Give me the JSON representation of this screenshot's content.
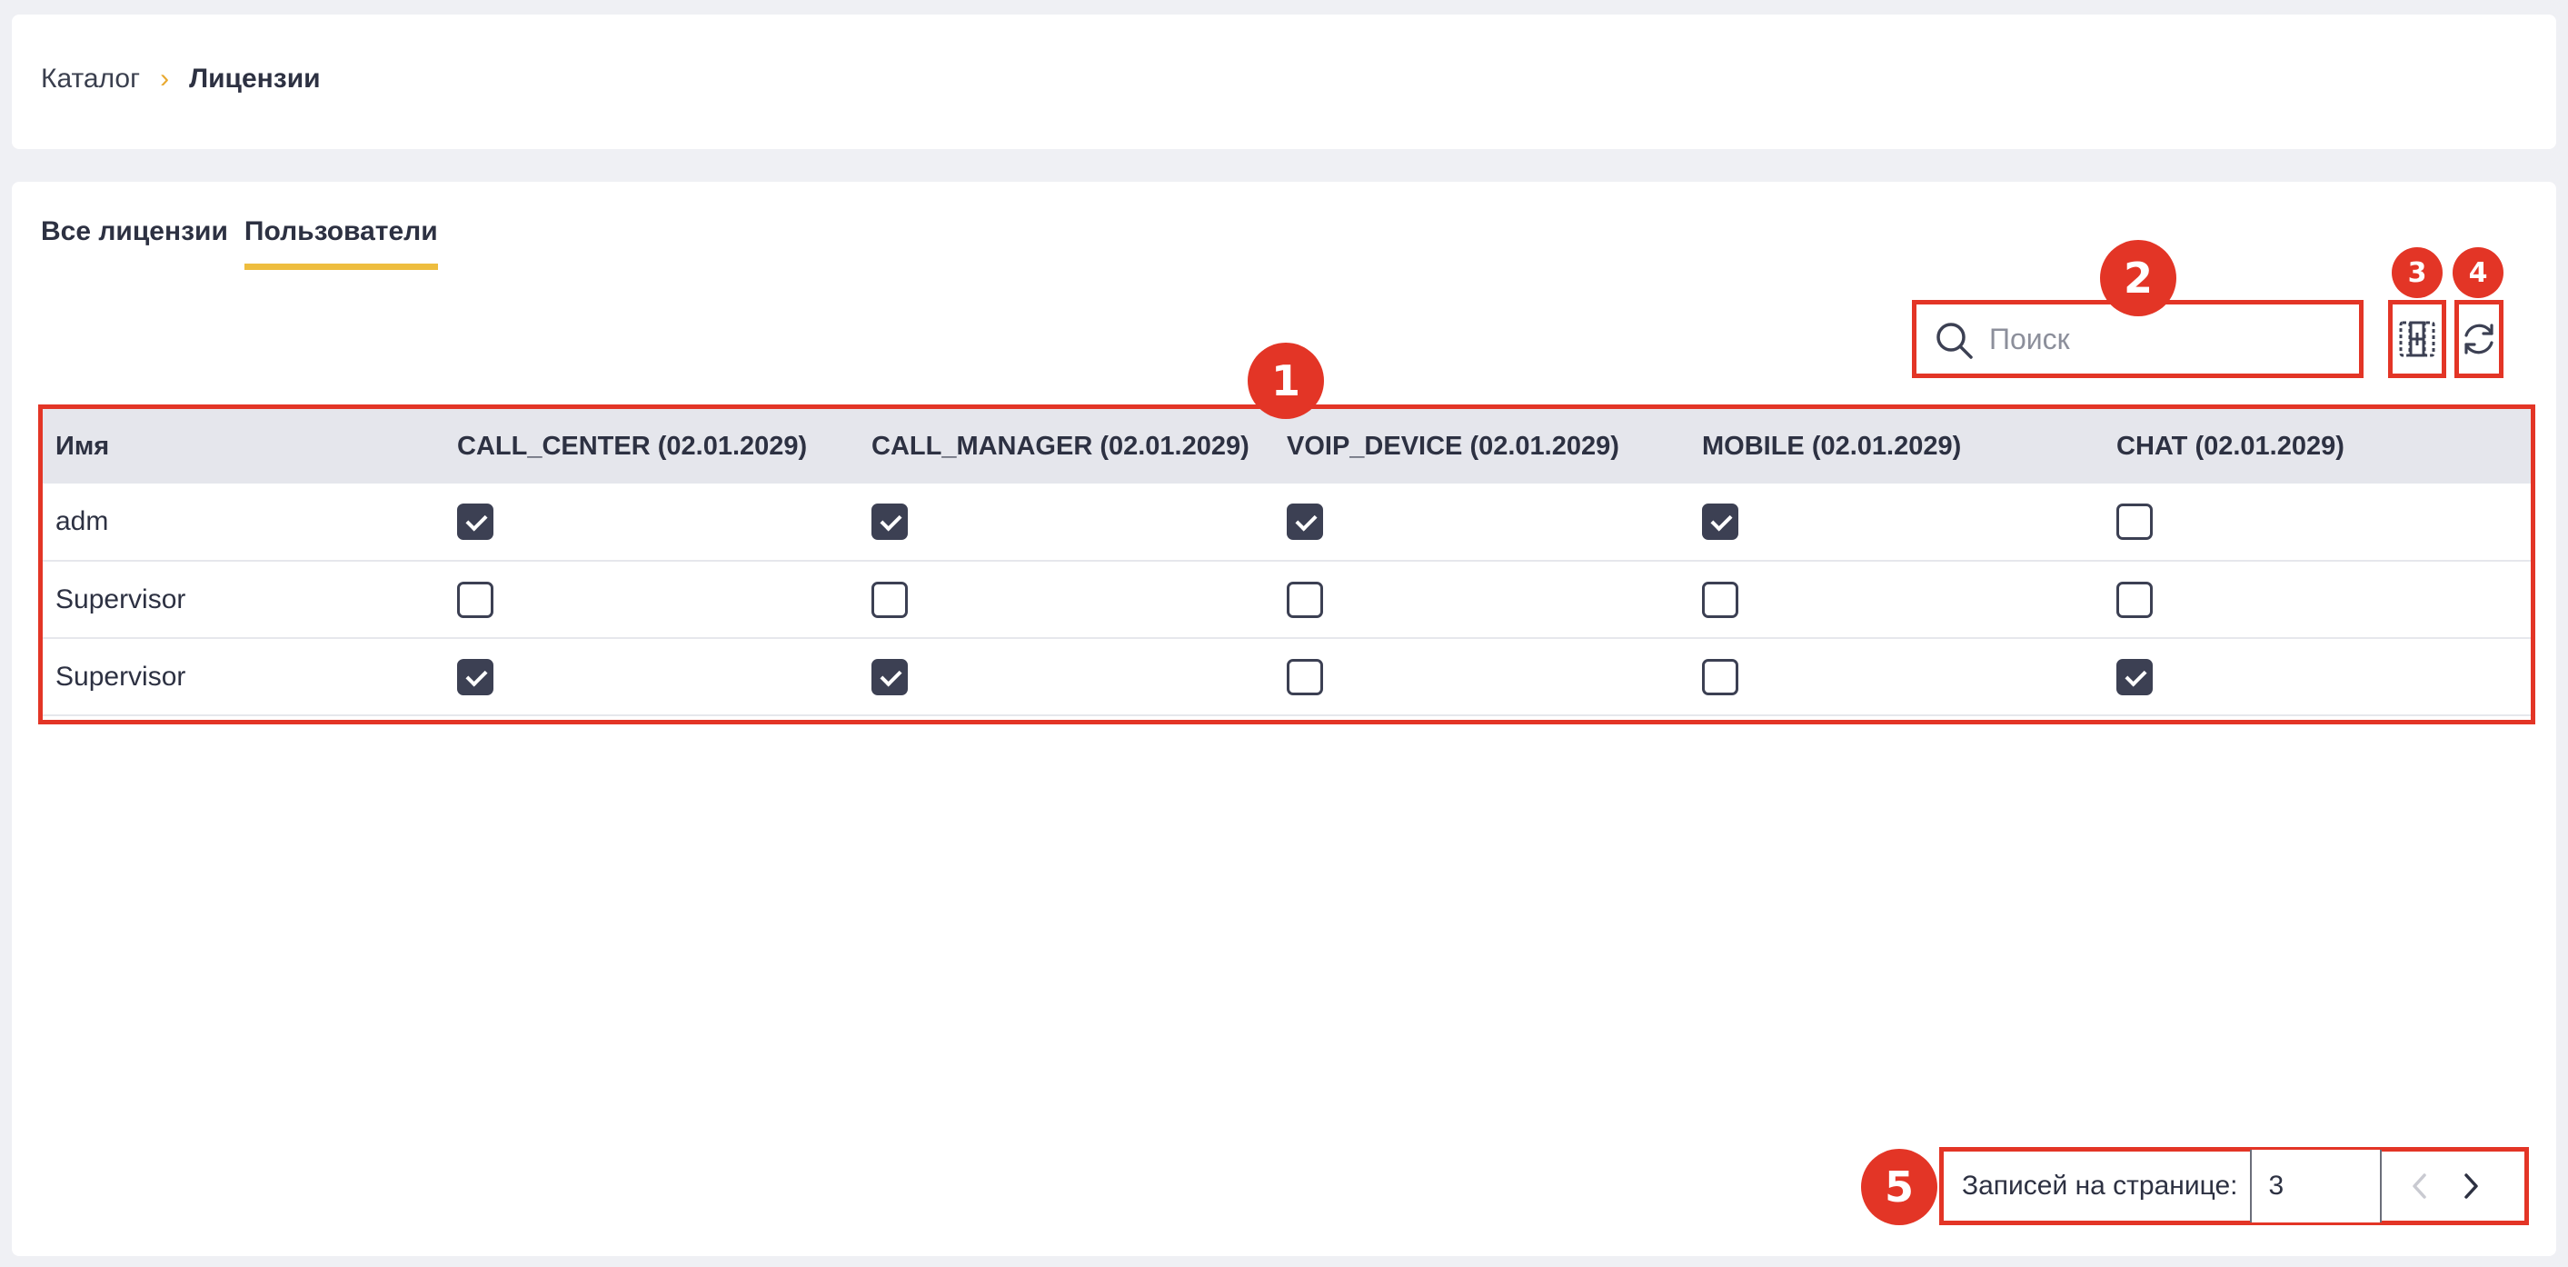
{
  "breadcrumb": {
    "root": "Каталог",
    "separator": "›",
    "current": "Лицензии"
  },
  "tabs": [
    {
      "label": "Все лицензии",
      "active": false
    },
    {
      "label": "Пользователи",
      "active": true
    }
  ],
  "search": {
    "placeholder": "Поиск",
    "value": ""
  },
  "toolbar": {
    "columns_icon": "column-settings-icon",
    "refresh_icon": "refresh-icon"
  },
  "table": {
    "columns": [
      "Имя",
      "CALL_CENTER (02.01.2029)",
      "CALL_MANAGER (02.01.2029)",
      "VOIP_DEVICE (02.01.2029)",
      "MOBILE (02.01.2029)",
      "CHAT (02.01.2029)"
    ],
    "rows": [
      {
        "name": "adm",
        "licenses": [
          true,
          true,
          true,
          true,
          false
        ]
      },
      {
        "name": "Supervisor",
        "licenses": [
          false,
          false,
          false,
          false,
          false
        ]
      },
      {
        "name": "Supervisor",
        "licenses": [
          true,
          true,
          false,
          false,
          true
        ]
      }
    ]
  },
  "pagination": {
    "label": "Записей на странице:",
    "page_size": "3"
  },
  "badges": [
    "1",
    "2",
    "3",
    "4",
    "5"
  ],
  "colors": {
    "accent": "#eebd3e",
    "highlight": "#e33526",
    "checkbox": "#3c4053"
  }
}
